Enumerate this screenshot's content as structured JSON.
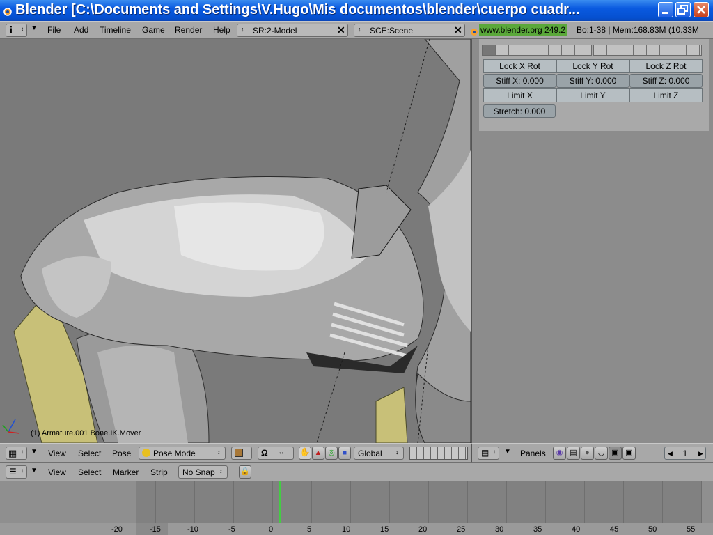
{
  "window": {
    "title": "Blender [C:\\Documents and Settings\\V.Hugo\\Mis documentos\\blender\\cuerpo cuadr..."
  },
  "topbar": {
    "menus": [
      "File",
      "Add",
      "Timeline",
      "Game",
      "Render",
      "Help"
    ],
    "screen_field": "SR:2-Model",
    "scene_field": "SCE:Scene",
    "site": "www.blender.org 249.2",
    "stats": "Bo:1-38  | Mem:168.83M (10.33M"
  },
  "viewport": {
    "object_label": "(1) Armature.001 Bone.IK.Mover",
    "header": {
      "menus": [
        "View",
        "Select",
        "Pose"
      ],
      "mode": "Pose Mode",
      "orientation": "Global"
    }
  },
  "properties": {
    "lock_buttons": [
      "Lock X Rot",
      "Lock Y Rot",
      "Lock Z Rot"
    ],
    "stiff_fields": [
      "Stiff X: 0.000",
      "Stiff Y: 0.000",
      "Stiff Z: 0.000"
    ],
    "limit_buttons": [
      "Limit X",
      "Limit Y",
      "Limit Z"
    ],
    "stretch_field": "Stretch: 0.000",
    "header": {
      "panels_label": "Panels",
      "frame_value": "1"
    }
  },
  "timeline": {
    "header": {
      "menus": [
        "View",
        "Select",
        "Marker",
        "Strip"
      ],
      "snap": "No Snap"
    },
    "ticks": [
      "-20",
      "-15",
      "-10",
      "-5",
      "0",
      "5",
      "10",
      "15",
      "20",
      "25",
      "30",
      "35",
      "40",
      "45",
      "50",
      "55"
    ],
    "current_frame_color": "#44cc44"
  },
  "colors": {
    "title_bar": "#0a5ae0",
    "header_bg": "#a8a8a8",
    "viewport_bg": "#7a7a7a",
    "panel_bg": "#b0b0b0",
    "mesh_yellow": "#c8c078"
  }
}
